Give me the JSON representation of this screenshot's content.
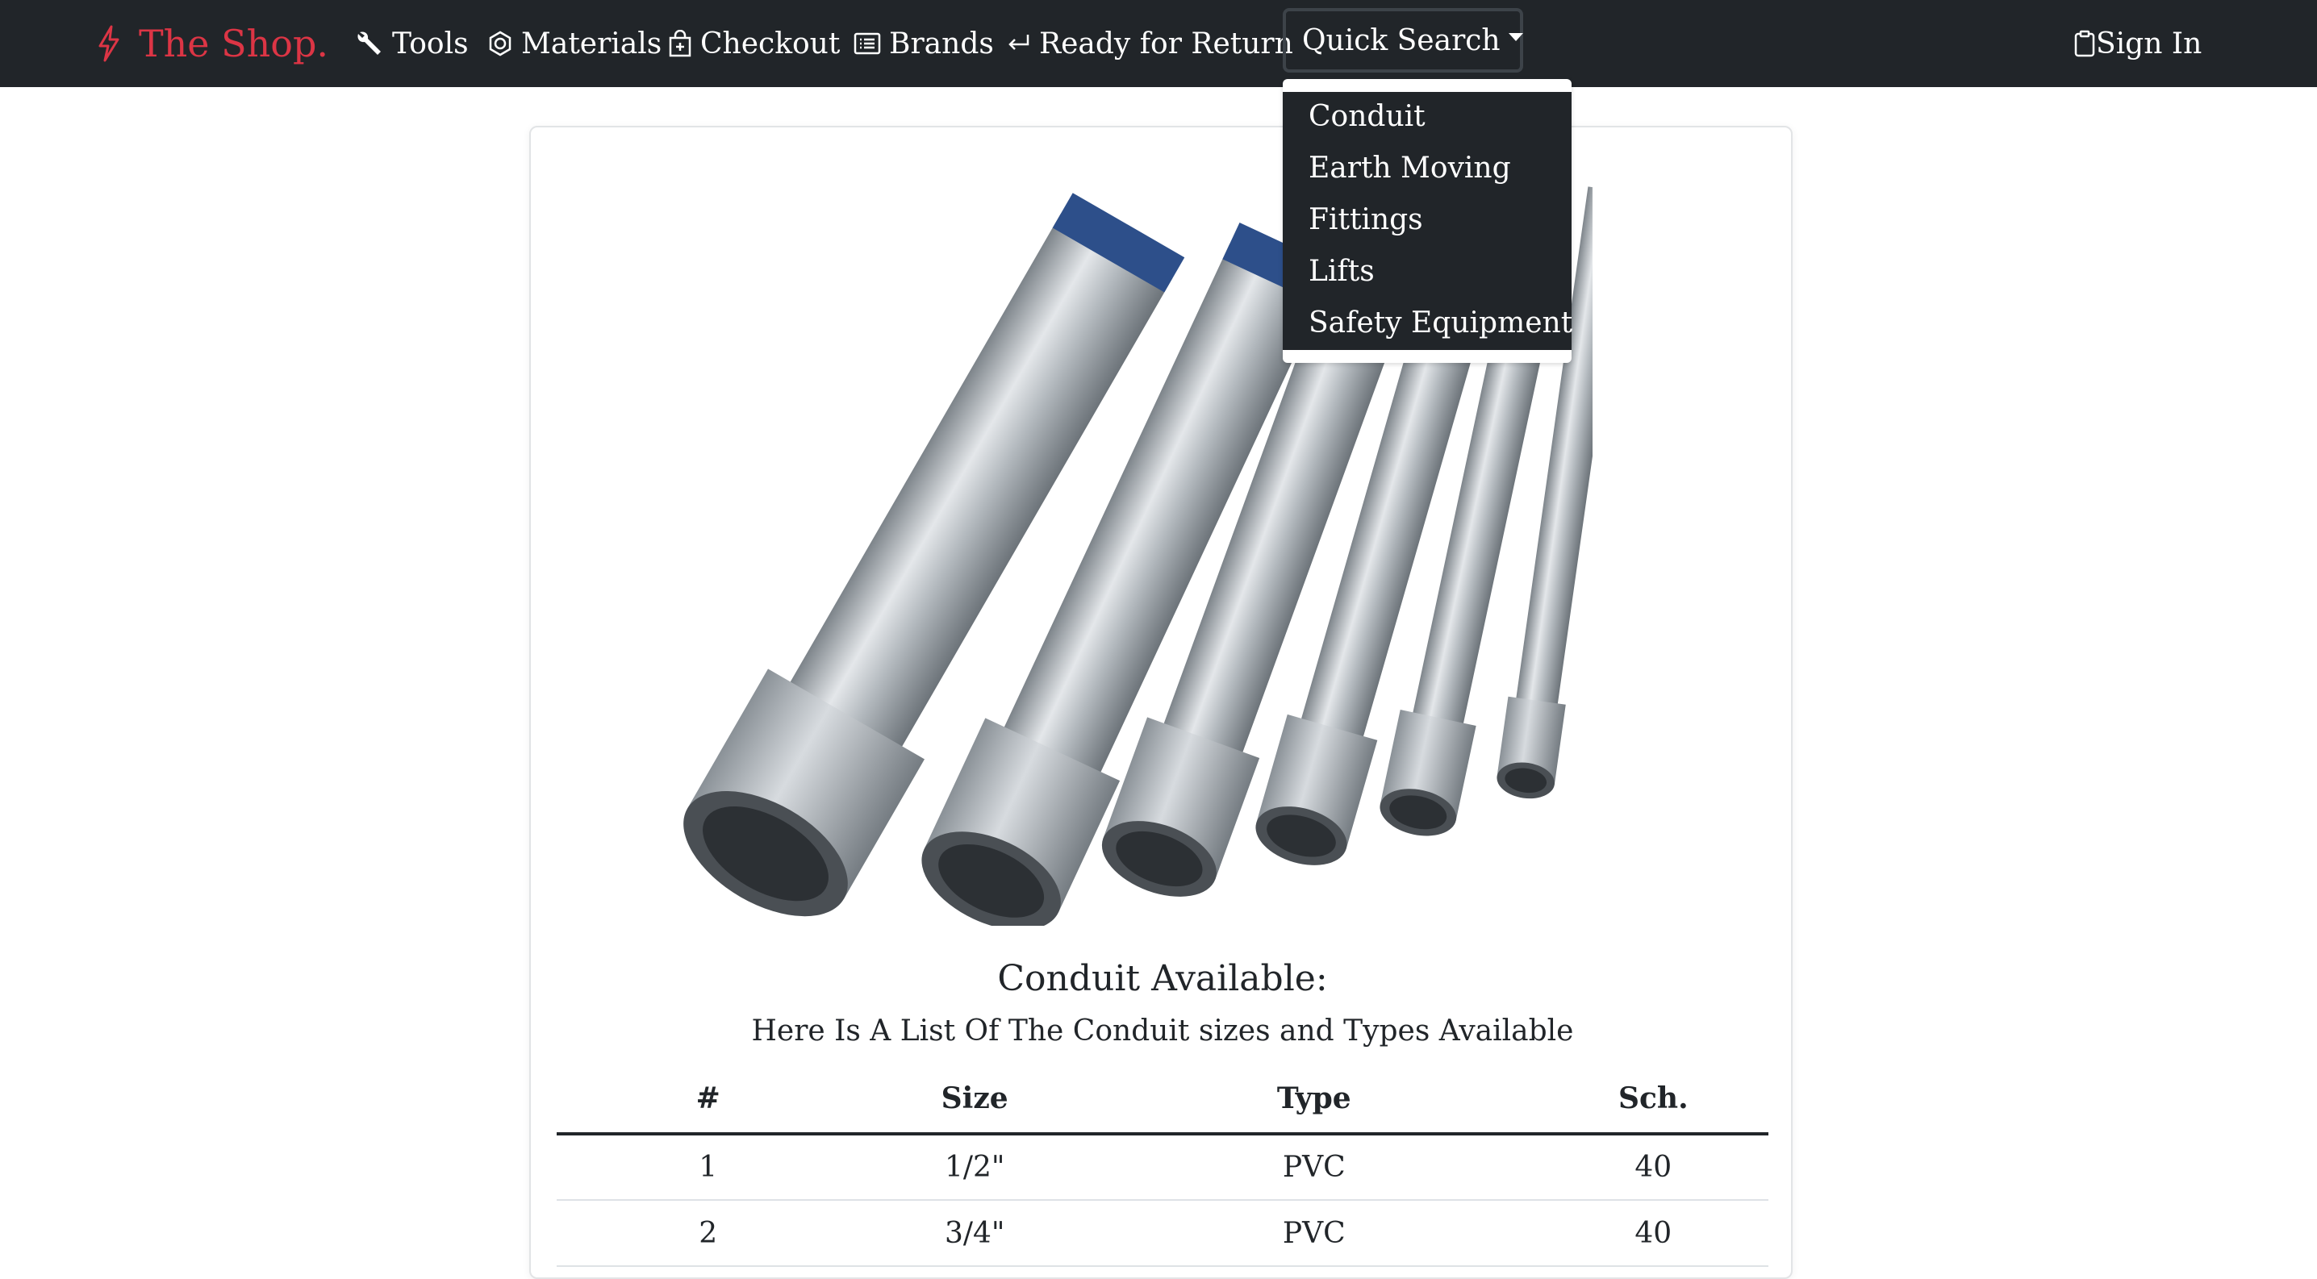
{
  "navbar": {
    "brand": "The Shop.",
    "items": [
      {
        "label": "Tools",
        "icon": "wrench-icon"
      },
      {
        "label": "Materials",
        "icon": "nut-icon"
      },
      {
        "label": "Checkout",
        "icon": "bag-plus-icon"
      },
      {
        "label": "Brands",
        "icon": "card-list-icon"
      },
      {
        "label": "Ready for Return",
        "icon": "return-arrow-icon"
      }
    ],
    "quick_search": {
      "label": "Quick Search",
      "options": [
        "Conduit",
        "Earth Moving",
        "Fittings",
        "Lifts",
        "Safety Equipment"
      ]
    },
    "sign_in": "Sign In"
  },
  "card": {
    "image": "galvanized-conduit-pipes",
    "title": "Conduit Available:",
    "subtitle": "Here Is A List Of The Conduit sizes and Types Available",
    "table": {
      "headers": [
        "#",
        "Size",
        "Type",
        "Sch."
      ],
      "rows": [
        [
          "1",
          "1/2\"",
          "PVC",
          "40"
        ],
        [
          "2",
          "3/4\"",
          "PVC",
          "40"
        ]
      ]
    }
  },
  "colors": {
    "navbar_bg": "#212529",
    "brand": "#dc3545",
    "text": "#212529"
  }
}
